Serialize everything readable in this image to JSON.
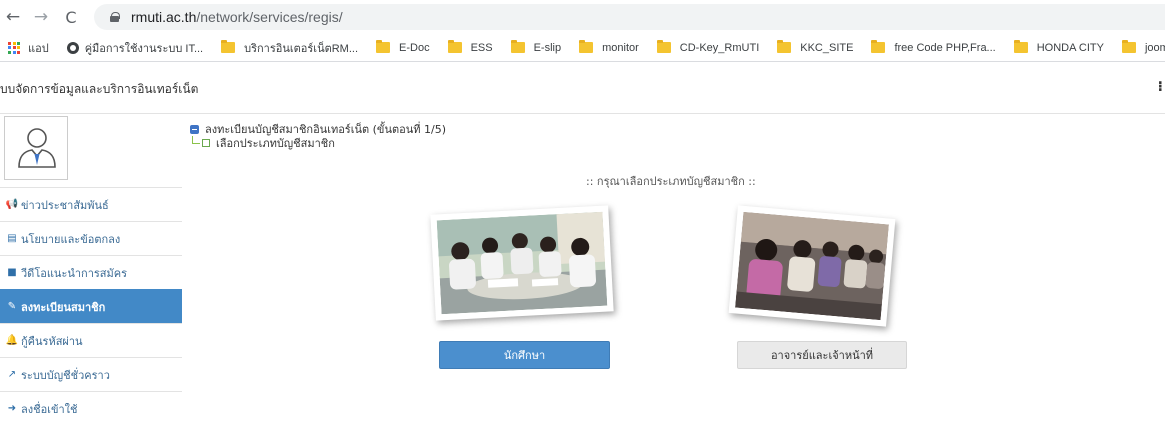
{
  "browser": {
    "url_host": "rmuti.ac.th",
    "url_path": "/network/services/regis/",
    "bookmarks": [
      {
        "label": "แอป",
        "icon": "apps-grid-icon"
      },
      {
        "label": "คู่มือการใช้งานระบบ IT...",
        "icon": "globe-icon"
      },
      {
        "label": "บริการอินเตอร์เน็ตRM...",
        "icon": "folder-icon"
      },
      {
        "label": "E-Doc",
        "icon": "folder-icon"
      },
      {
        "label": "ESS",
        "icon": "folder-icon"
      },
      {
        "label": "E-slip",
        "icon": "folder-icon"
      },
      {
        "label": "monitor",
        "icon": "folder-icon"
      },
      {
        "label": "CD-Key_RmUTI",
        "icon": "folder-icon"
      },
      {
        "label": "KKC_SITE",
        "icon": "folder-icon"
      },
      {
        "label": "free Code PHP,Fra...",
        "icon": "folder-icon"
      },
      {
        "label": "HONDA CITY",
        "icon": "folder-icon"
      },
      {
        "label": "joomla",
        "icon": "folder-icon"
      },
      {
        "label": "",
        "icon": "folder-icon"
      }
    ]
  },
  "header": {
    "title": "บบจัดการข้อมูลและบริการอินเทอร์เน็ต",
    "dots": "⁝"
  },
  "sidebar": {
    "items": [
      {
        "label": "ข่าวประชาสัมพันธ์",
        "icon": "megaphone-icon",
        "glyph": "📢"
      },
      {
        "label": "นโยบายและข้อตกลง",
        "icon": "document-icon",
        "glyph": "▤"
      },
      {
        "label": "วีดีโอแนะนำการสมัคร",
        "icon": "video-camera-icon",
        "glyph": "■"
      },
      {
        "label": "ลงทะเบียนสมาชิก",
        "icon": "edit-icon",
        "glyph": "✎"
      },
      {
        "label": "กู้คืนรหัสผ่าน",
        "icon": "bell-icon",
        "glyph": "🔔"
      },
      {
        "label": "ระบบบัญชีชั่วคราว",
        "icon": "share-icon",
        "glyph": "↗"
      },
      {
        "label": "ลงชื่อเข้าใช้",
        "icon": "sign-in-icon",
        "glyph": "➜"
      }
    ]
  },
  "content": {
    "step_title": "ลงทะเบียนบัญชีสมาชิกอินเทอร์เน็ต (ขั้นตอนที่ 1/5)",
    "substep": "เลือกประเภทบัญชีสมาชิก",
    "choose_heading": ":: กรุณาเลือกประเภทบัญชีสมาชิก ::",
    "student_button": "นักศึกษา",
    "staff_button": "อาจารย์และเจ้าหน้าที่"
  },
  "colors": {
    "accent": "#4289c7",
    "student_button": "#4b8fce",
    "staff_button": "#eaeaea"
  }
}
